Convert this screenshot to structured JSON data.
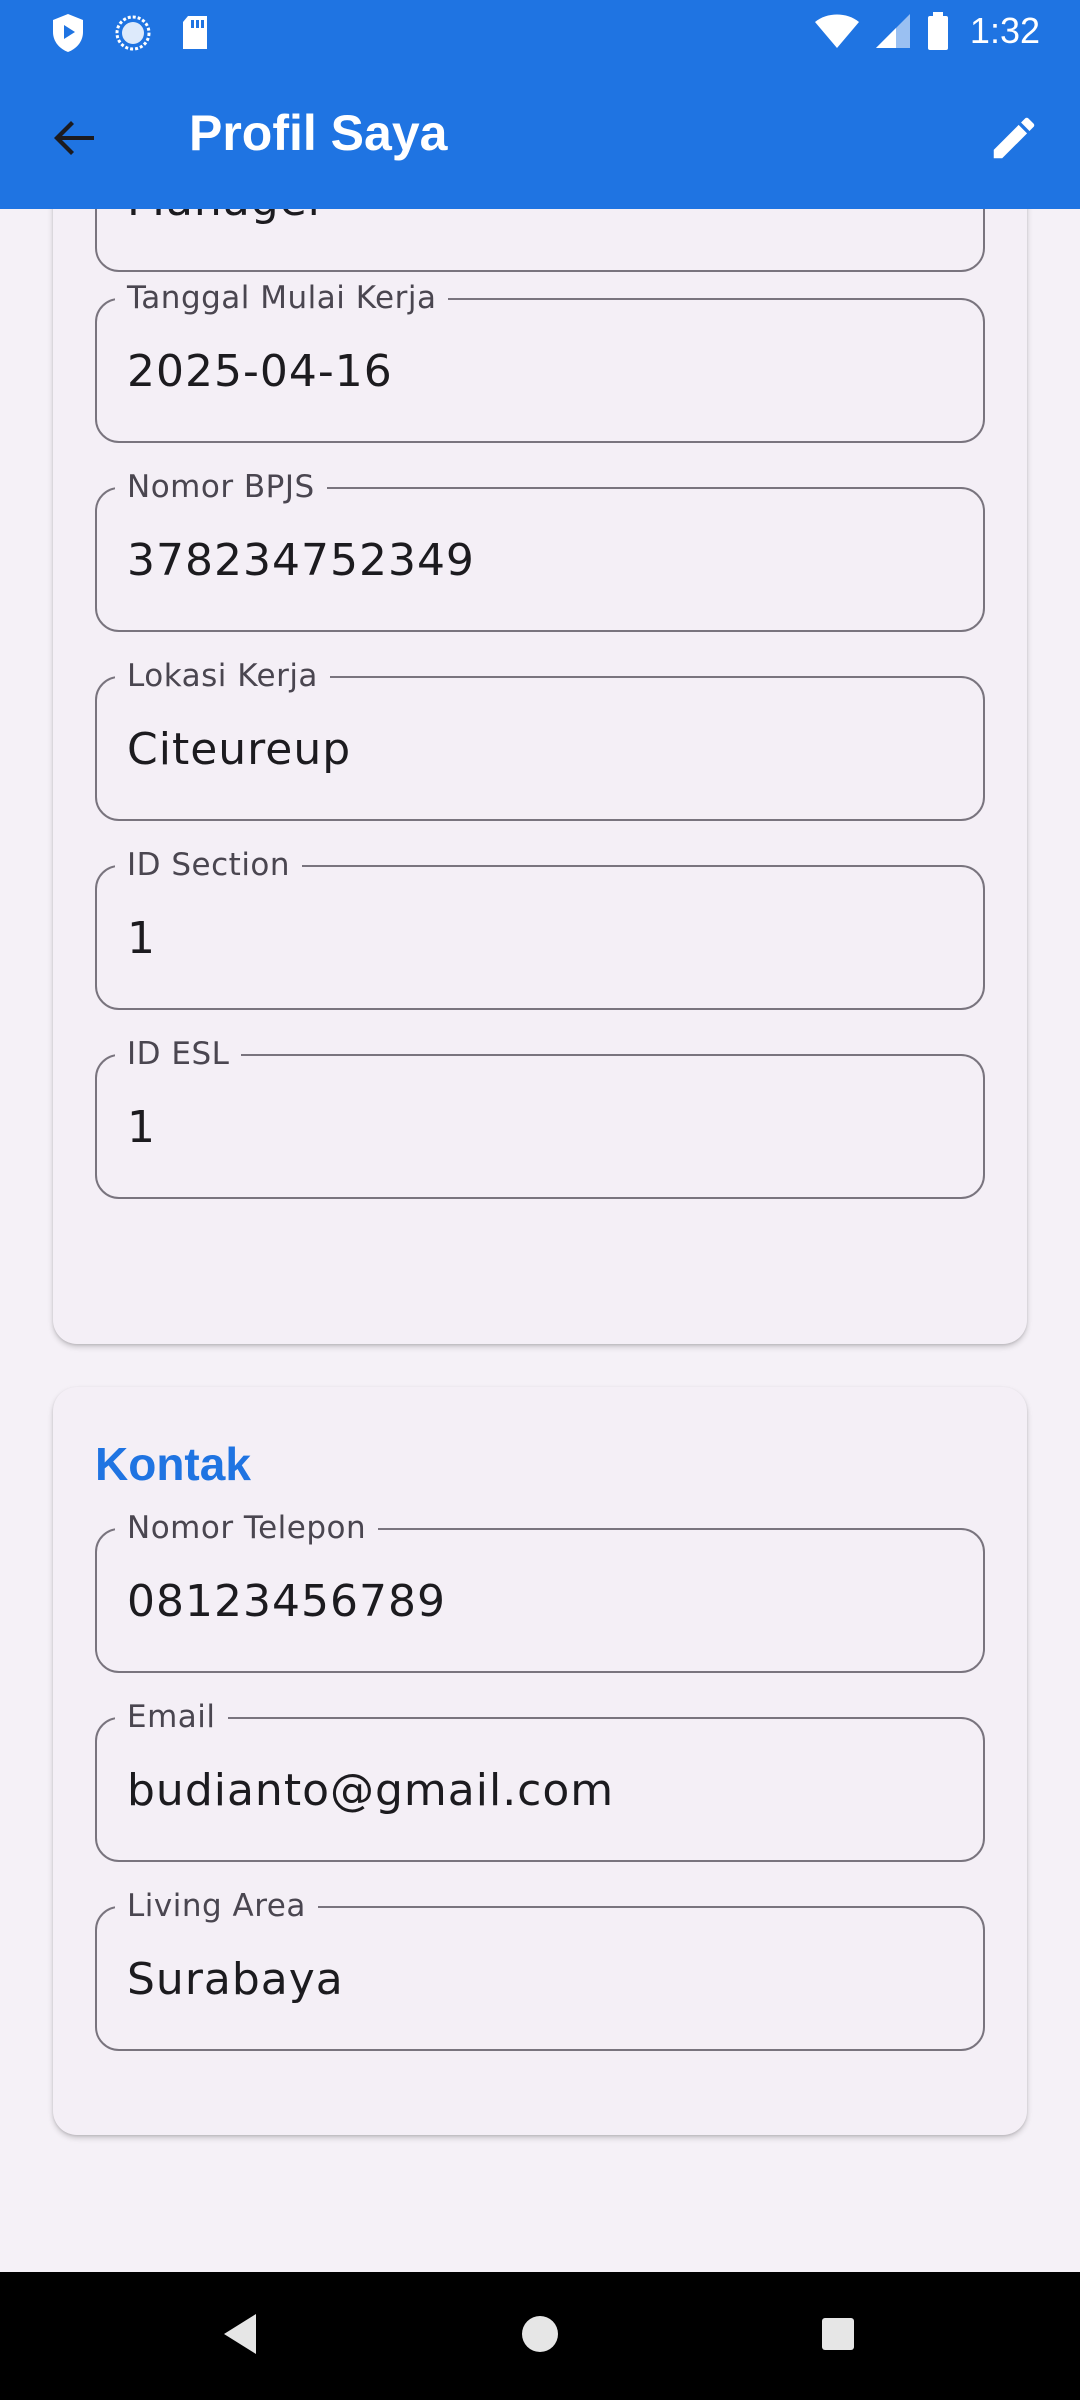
{
  "status_bar": {
    "time": "1:32",
    "icons": [
      "shield-play-icon",
      "loading-circle-icon",
      "sd-card-icon",
      "wifi-icon",
      "signal-icon",
      "battery-icon"
    ]
  },
  "app_bar": {
    "title": "Profil Saya",
    "back_icon": "arrow-back-icon",
    "edit_icon": "pencil-icon",
    "color": "#1f74e2"
  },
  "card_employment": {
    "fields": [
      {
        "label": "",
        "value": "Manager"
      },
      {
        "label": "Tanggal Mulai Kerja",
        "value": "2025-04-16"
      },
      {
        "label": "Nomor BPJS",
        "value": "378234752349"
      },
      {
        "label": "Lokasi Kerja",
        "value": "Citeureup"
      },
      {
        "label": "ID Section",
        "value": "1"
      },
      {
        "label": "ID ESL",
        "value": "1"
      }
    ]
  },
  "card_contact": {
    "title": "Kontak",
    "fields": [
      {
        "label": "Nomor Telepon",
        "value": "08123456789"
      },
      {
        "label": "Email",
        "value": "budianto@gmail.com"
      },
      {
        "label": "Living Area",
        "value": "Surabaya"
      }
    ]
  },
  "nav_bar": {
    "icons": [
      "nav-back-icon",
      "nav-home-icon",
      "nav-recents-icon"
    ]
  }
}
